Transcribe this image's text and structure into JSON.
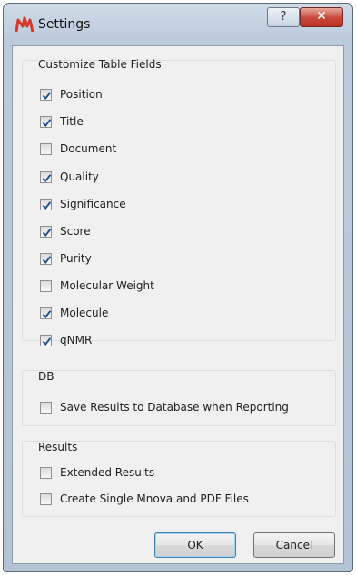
{
  "window": {
    "title": "Settings",
    "help_glyph": "?",
    "close_glyph": "✕",
    "app_icon": "mnova-logo-icon",
    "colors": {
      "accent": "#d13a2f",
      "check": "#1f4e8c",
      "frame": "#b9c9da"
    }
  },
  "groups": {
    "table_fields": {
      "title": "Customize Table Fields",
      "items": [
        {
          "label": "Position",
          "checked": true
        },
        {
          "label": "Title",
          "checked": true
        },
        {
          "label": "Document",
          "checked": false
        },
        {
          "label": "Quality",
          "checked": true
        },
        {
          "label": "Significance",
          "checked": true
        },
        {
          "label": "Score",
          "checked": true
        },
        {
          "label": "Purity",
          "checked": true
        },
        {
          "label": "Molecular Weight",
          "checked": false
        },
        {
          "label": "Molecule",
          "checked": true
        },
        {
          "label": "qNMR",
          "checked": true
        }
      ]
    },
    "db": {
      "title": "DB",
      "items": [
        {
          "label": "Save Results to Database when Reporting",
          "checked": false
        }
      ]
    },
    "results": {
      "title": "Results",
      "items": [
        {
          "label": "Extended Results",
          "checked": false
        },
        {
          "label": "Create Single Mnova and PDF Files",
          "checked": false
        }
      ]
    }
  },
  "buttons": {
    "ok": "OK",
    "cancel": "Cancel"
  }
}
